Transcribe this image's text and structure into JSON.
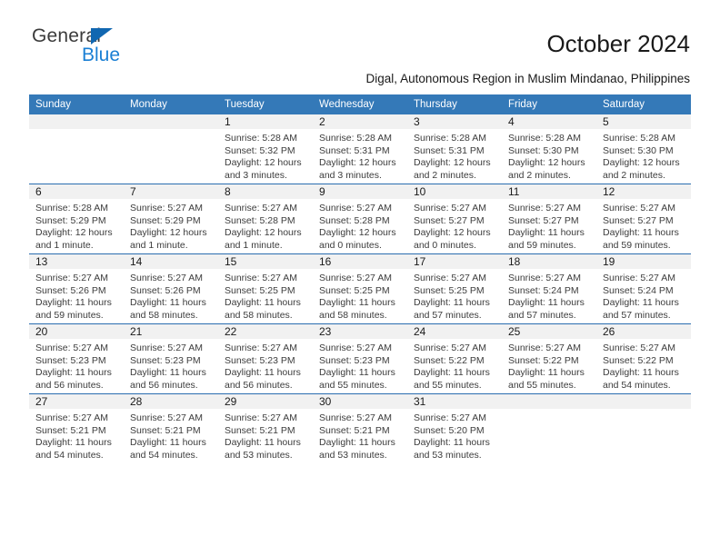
{
  "brand": {
    "name_top": "General",
    "name_bottom": "Blue"
  },
  "header": {
    "title": "October 2024",
    "subtitle": "Digal, Autonomous Region in Muslim Mindanao, Philippines"
  },
  "colors": {
    "header_blue": "#3479b8",
    "row_border_blue": "#2a6db0",
    "daynum_band": "#f1f1f1",
    "logo_blue": "#1a7fd4",
    "text": "#1a1a1a"
  },
  "weekday_headers": [
    "Sunday",
    "Monday",
    "Tuesday",
    "Wednesday",
    "Thursday",
    "Friday",
    "Saturday"
  ],
  "labels": {
    "sunrise_prefix": "Sunrise:",
    "sunset_prefix": "Sunset:",
    "daylight_prefix": "Daylight:"
  },
  "weeks": [
    [
      {
        "day": "",
        "empty": true
      },
      {
        "day": "",
        "empty": true
      },
      {
        "day": "1",
        "sunrise": "Sunrise: 5:28 AM",
        "sunset": "Sunset: 5:32 PM",
        "daylight": "Daylight: 12 hours and 3 minutes."
      },
      {
        "day": "2",
        "sunrise": "Sunrise: 5:28 AM",
        "sunset": "Sunset: 5:31 PM",
        "daylight": "Daylight: 12 hours and 3 minutes."
      },
      {
        "day": "3",
        "sunrise": "Sunrise: 5:28 AM",
        "sunset": "Sunset: 5:31 PM",
        "daylight": "Daylight: 12 hours and 2 minutes."
      },
      {
        "day": "4",
        "sunrise": "Sunrise: 5:28 AM",
        "sunset": "Sunset: 5:30 PM",
        "daylight": "Daylight: 12 hours and 2 minutes."
      },
      {
        "day": "5",
        "sunrise": "Sunrise: 5:28 AM",
        "sunset": "Sunset: 5:30 PM",
        "daylight": "Daylight: 12 hours and 2 minutes."
      }
    ],
    [
      {
        "day": "6",
        "sunrise": "Sunrise: 5:28 AM",
        "sunset": "Sunset: 5:29 PM",
        "daylight": "Daylight: 12 hours and 1 minute."
      },
      {
        "day": "7",
        "sunrise": "Sunrise: 5:27 AM",
        "sunset": "Sunset: 5:29 PM",
        "daylight": "Daylight: 12 hours and 1 minute."
      },
      {
        "day": "8",
        "sunrise": "Sunrise: 5:27 AM",
        "sunset": "Sunset: 5:28 PM",
        "daylight": "Daylight: 12 hours and 1 minute."
      },
      {
        "day": "9",
        "sunrise": "Sunrise: 5:27 AM",
        "sunset": "Sunset: 5:28 PM",
        "daylight": "Daylight: 12 hours and 0 minutes."
      },
      {
        "day": "10",
        "sunrise": "Sunrise: 5:27 AM",
        "sunset": "Sunset: 5:27 PM",
        "daylight": "Daylight: 12 hours and 0 minutes."
      },
      {
        "day": "11",
        "sunrise": "Sunrise: 5:27 AM",
        "sunset": "Sunset: 5:27 PM",
        "daylight": "Daylight: 11 hours and 59 minutes."
      },
      {
        "day": "12",
        "sunrise": "Sunrise: 5:27 AM",
        "sunset": "Sunset: 5:27 PM",
        "daylight": "Daylight: 11 hours and 59 minutes."
      }
    ],
    [
      {
        "day": "13",
        "sunrise": "Sunrise: 5:27 AM",
        "sunset": "Sunset: 5:26 PM",
        "daylight": "Daylight: 11 hours and 59 minutes."
      },
      {
        "day": "14",
        "sunrise": "Sunrise: 5:27 AM",
        "sunset": "Sunset: 5:26 PM",
        "daylight": "Daylight: 11 hours and 58 minutes."
      },
      {
        "day": "15",
        "sunrise": "Sunrise: 5:27 AM",
        "sunset": "Sunset: 5:25 PM",
        "daylight": "Daylight: 11 hours and 58 minutes."
      },
      {
        "day": "16",
        "sunrise": "Sunrise: 5:27 AM",
        "sunset": "Sunset: 5:25 PM",
        "daylight": "Daylight: 11 hours and 58 minutes."
      },
      {
        "day": "17",
        "sunrise": "Sunrise: 5:27 AM",
        "sunset": "Sunset: 5:25 PM",
        "daylight": "Daylight: 11 hours and 57 minutes."
      },
      {
        "day": "18",
        "sunrise": "Sunrise: 5:27 AM",
        "sunset": "Sunset: 5:24 PM",
        "daylight": "Daylight: 11 hours and 57 minutes."
      },
      {
        "day": "19",
        "sunrise": "Sunrise: 5:27 AM",
        "sunset": "Sunset: 5:24 PM",
        "daylight": "Daylight: 11 hours and 57 minutes."
      }
    ],
    [
      {
        "day": "20",
        "sunrise": "Sunrise: 5:27 AM",
        "sunset": "Sunset: 5:23 PM",
        "daylight": "Daylight: 11 hours and 56 minutes."
      },
      {
        "day": "21",
        "sunrise": "Sunrise: 5:27 AM",
        "sunset": "Sunset: 5:23 PM",
        "daylight": "Daylight: 11 hours and 56 minutes."
      },
      {
        "day": "22",
        "sunrise": "Sunrise: 5:27 AM",
        "sunset": "Sunset: 5:23 PM",
        "daylight": "Daylight: 11 hours and 56 minutes."
      },
      {
        "day": "23",
        "sunrise": "Sunrise: 5:27 AM",
        "sunset": "Sunset: 5:23 PM",
        "daylight": "Daylight: 11 hours and 55 minutes."
      },
      {
        "day": "24",
        "sunrise": "Sunrise: 5:27 AM",
        "sunset": "Sunset: 5:22 PM",
        "daylight": "Daylight: 11 hours and 55 minutes."
      },
      {
        "day": "25",
        "sunrise": "Sunrise: 5:27 AM",
        "sunset": "Sunset: 5:22 PM",
        "daylight": "Daylight: 11 hours and 55 minutes."
      },
      {
        "day": "26",
        "sunrise": "Sunrise: 5:27 AM",
        "sunset": "Sunset: 5:22 PM",
        "daylight": "Daylight: 11 hours and 54 minutes."
      }
    ],
    [
      {
        "day": "27",
        "sunrise": "Sunrise: 5:27 AM",
        "sunset": "Sunset: 5:21 PM",
        "daylight": "Daylight: 11 hours and 54 minutes."
      },
      {
        "day": "28",
        "sunrise": "Sunrise: 5:27 AM",
        "sunset": "Sunset: 5:21 PM",
        "daylight": "Daylight: 11 hours and 54 minutes."
      },
      {
        "day": "29",
        "sunrise": "Sunrise: 5:27 AM",
        "sunset": "Sunset: 5:21 PM",
        "daylight": "Daylight: 11 hours and 53 minutes."
      },
      {
        "day": "30",
        "sunrise": "Sunrise: 5:27 AM",
        "sunset": "Sunset: 5:21 PM",
        "daylight": "Daylight: 11 hours and 53 minutes."
      },
      {
        "day": "31",
        "sunrise": "Sunrise: 5:27 AM",
        "sunset": "Sunset: 5:20 PM",
        "daylight": "Daylight: 11 hours and 53 minutes."
      },
      {
        "day": "",
        "empty": true
      },
      {
        "day": "",
        "empty": true
      }
    ]
  ]
}
